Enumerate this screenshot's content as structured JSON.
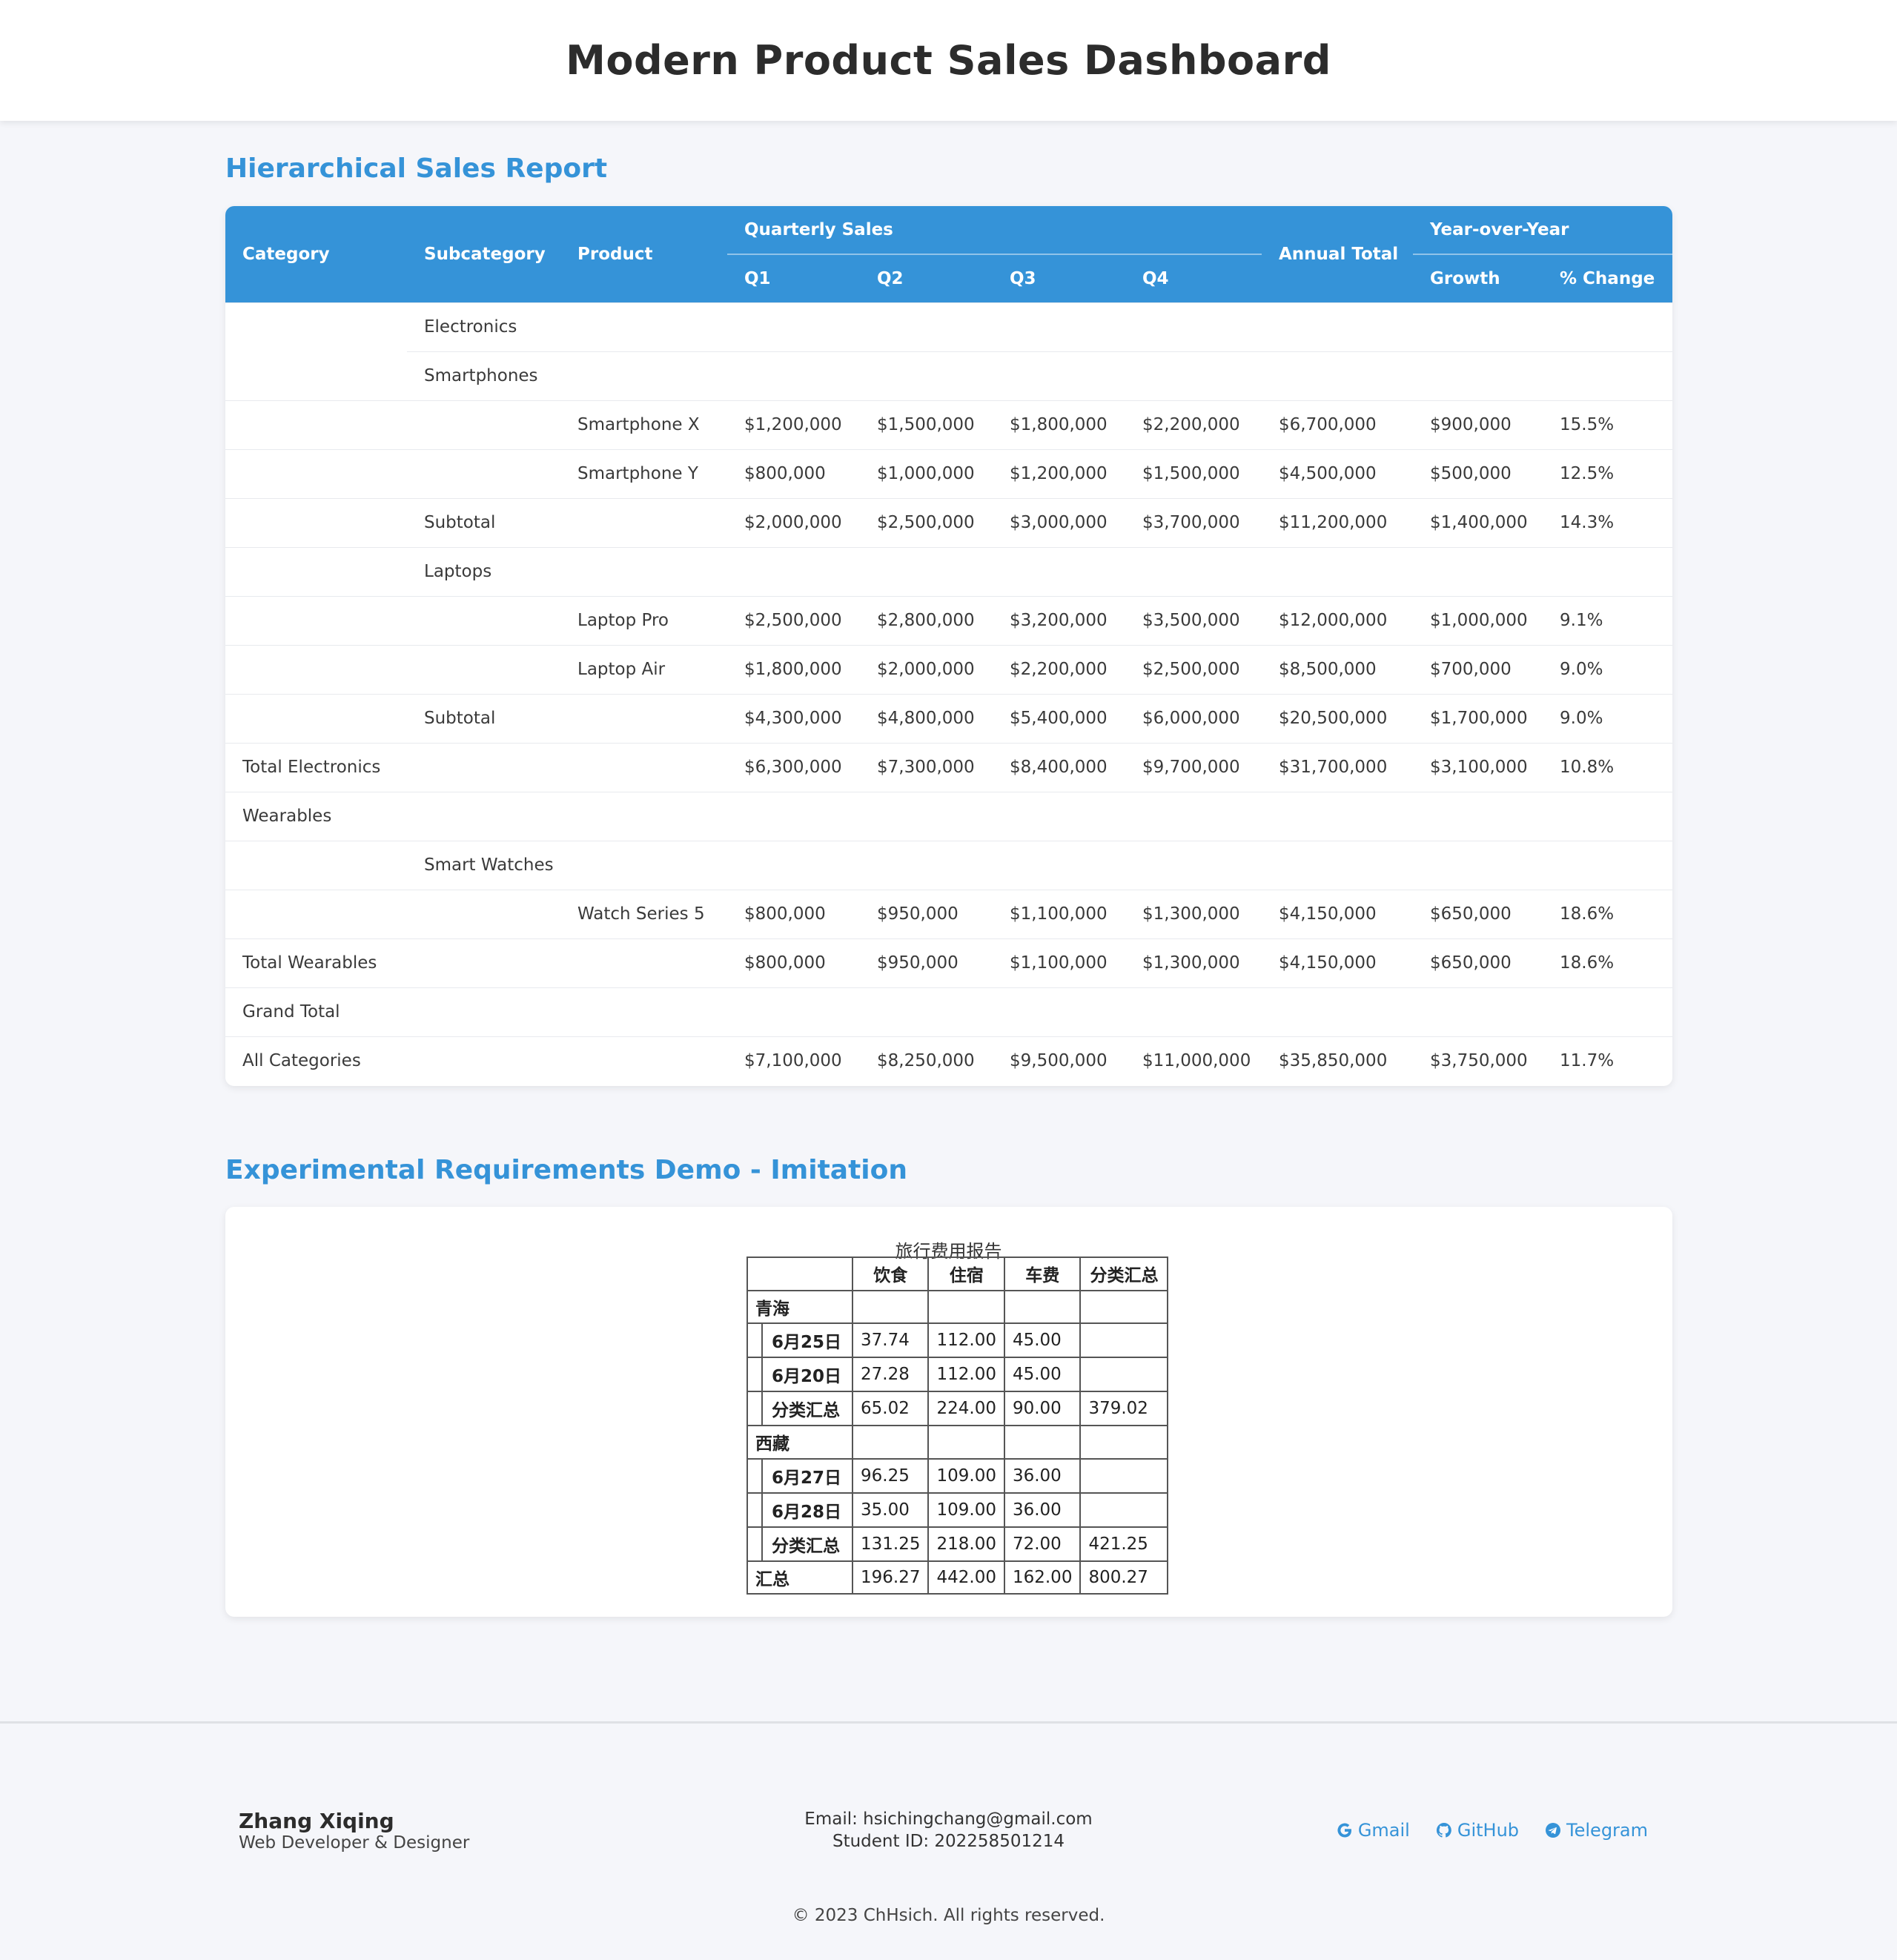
{
  "header": {
    "title": "Modern Product Sales Dashboard"
  },
  "sales": {
    "title": "Hierarchical Sales Report",
    "headers": {
      "category": "Category",
      "subcategory": "Subcategory",
      "product": "Product",
      "quarterly": "Quarterly Sales",
      "q1": "Q1",
      "q2": "Q2",
      "q3": "Q3",
      "q4": "Q4",
      "annual": "Annual Total",
      "yoy": "Year-over-Year",
      "growth": "Growth",
      "pct": "% Change"
    },
    "rows": [
      [
        "",
        "Electronics",
        "",
        "",
        "",
        "",
        "",
        "",
        "",
        ""
      ],
      [
        "",
        "Smartphones",
        "",
        "",
        "",
        "",
        "",
        "",
        "",
        ""
      ],
      [
        "",
        "",
        "Smartphone X",
        "$1,200,000",
        "$1,500,000",
        "$1,800,000",
        "$2,200,000",
        "$6,700,000",
        "$900,000",
        "15.5%"
      ],
      [
        "",
        "",
        "Smartphone Y",
        "$800,000",
        "$1,000,000",
        "$1,200,000",
        "$1,500,000",
        "$4,500,000",
        "$500,000",
        "12.5%"
      ],
      [
        "",
        "Subtotal",
        "",
        "$2,000,000",
        "$2,500,000",
        "$3,000,000",
        "$3,700,000",
        "$11,200,000",
        "$1,400,000",
        "14.3%"
      ],
      [
        "",
        "Laptops",
        "",
        "",
        "",
        "",
        "",
        "",
        "",
        ""
      ],
      [
        "",
        "",
        "Laptop Pro",
        "$2,500,000",
        "$2,800,000",
        "$3,200,000",
        "$3,500,000",
        "$12,000,000",
        "$1,000,000",
        "9.1%"
      ],
      [
        "",
        "",
        "Laptop Air",
        "$1,800,000",
        "$2,000,000",
        "$2,200,000",
        "$2,500,000",
        "$8,500,000",
        "$700,000",
        "9.0%"
      ],
      [
        "",
        "Subtotal",
        "",
        "$4,300,000",
        "$4,800,000",
        "$5,400,000",
        "$6,000,000",
        "$20,500,000",
        "$1,700,000",
        "9.0%"
      ],
      [
        "Total Electronics",
        "",
        "",
        "$6,300,000",
        "$7,300,000",
        "$8,400,000",
        "$9,700,000",
        "$31,700,000",
        "$3,100,000",
        "10.8%"
      ],
      [
        "Wearables",
        "",
        "",
        "",
        "",
        "",
        "",
        "",
        "",
        ""
      ],
      [
        "",
        "Smart Watches",
        "",
        "",
        "",
        "",
        "",
        "",
        "",
        ""
      ],
      [
        "",
        "",
        "Watch Series 5",
        "$800,000",
        "$950,000",
        "$1,100,000",
        "$1,300,000",
        "$4,150,000",
        "$650,000",
        "18.6%"
      ],
      [
        "Total Wearables",
        "",
        "",
        "$800,000",
        "$950,000",
        "$1,100,000",
        "$1,300,000",
        "$4,150,000",
        "$650,000",
        "18.6%"
      ],
      [
        "Grand Total",
        "",
        "",
        "",
        "",
        "",
        "",
        "",
        "",
        ""
      ],
      [
        "All Categories",
        "",
        "",
        "$7,100,000",
        "$8,250,000",
        "$9,500,000",
        "$11,000,000",
        "$35,850,000",
        "$3,750,000",
        "11.7%"
      ]
    ]
  },
  "demo": {
    "title": "Experimental Requirements Demo - Imitation",
    "table_title": "旅行费用报告",
    "headers": [
      "",
      "饮食",
      "住宿",
      "车费",
      "分类汇总"
    ],
    "rows": [
      {
        "label": "青海",
        "indent": false,
        "cells": [
          "",
          "",
          "",
          ""
        ]
      },
      {
        "label": "6月25日",
        "indent": true,
        "cells": [
          "37.74",
          "112.00",
          "45.00",
          ""
        ]
      },
      {
        "label": "6月20日",
        "indent": true,
        "cells": [
          "27.28",
          "112.00",
          "45.00",
          ""
        ]
      },
      {
        "label": "分类汇总",
        "indent": true,
        "cells": [
          "65.02",
          "224.00",
          "90.00",
          "379.02"
        ]
      },
      {
        "label": "西藏",
        "indent": false,
        "cells": [
          "",
          "",
          "",
          ""
        ]
      },
      {
        "label": "6月27日",
        "indent": true,
        "cells": [
          "96.25",
          "109.00",
          "36.00",
          ""
        ]
      },
      {
        "label": "6月28日",
        "indent": true,
        "cells": [
          "35.00",
          "109.00",
          "36.00",
          ""
        ]
      },
      {
        "label": "分类汇总",
        "indent": true,
        "cells": [
          "131.25",
          "218.00",
          "72.00",
          "421.25"
        ]
      },
      {
        "label": "汇总",
        "indent": false,
        "cells": [
          "196.27",
          "442.00",
          "162.00",
          "800.27"
        ]
      }
    ]
  },
  "footer": {
    "name": "Zhang Xiqing",
    "role": "Web Developer & Designer",
    "email": "Email: hsichingchang@gmail.com",
    "student_id": "Student ID: 202258501214",
    "links": [
      "Gmail",
      "GitHub",
      "Telegram"
    ],
    "copyright": "© 2023 ChHsich. All rights reserved.",
    "accent": "#3593d8"
  }
}
